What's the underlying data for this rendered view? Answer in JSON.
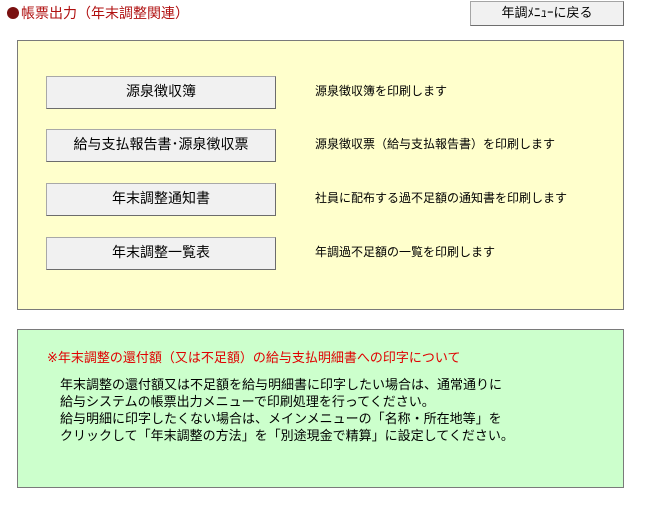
{
  "header": {
    "title": "帳票出力（年末調整関連）",
    "back_label": "年調ﾒﾆｭｰに戻る"
  },
  "menu": {
    "items": [
      {
        "label": "源泉徴収簿",
        "description": "源泉徴収簿を印刷します"
      },
      {
        "label": "給与支払報告書･源泉徴収票",
        "description": "源泉徴収票（給与支払報告書）を印刷します"
      },
      {
        "label": "年末調整通知書",
        "description": "社員に配布する過不足額の通知書を印刷します"
      },
      {
        "label": "年末調整一覧表",
        "description": "年調過不足額の一覧を印刷します"
      }
    ]
  },
  "notice": {
    "title": "※年末調整の還付額（又は不足額）の給与支払明細書への印字について",
    "lines": [
      "年末調整の還付額又は不足額を給与明細書に印字したい場合は、通常通りに",
      "給与システムの帳票出力メニューで印刷処理を行ってください。",
      "給与明細に印字したくない場合は、メインメニューの「名称・所在地等」を",
      "クリックして「年末調整の方法」を「別途現金で精算」に設定してください。"
    ]
  },
  "colors": {
    "title": "#b01010",
    "button_panel": "#ffffcc",
    "notice_panel": "#ccffcc",
    "notice_title": "#e00000"
  }
}
